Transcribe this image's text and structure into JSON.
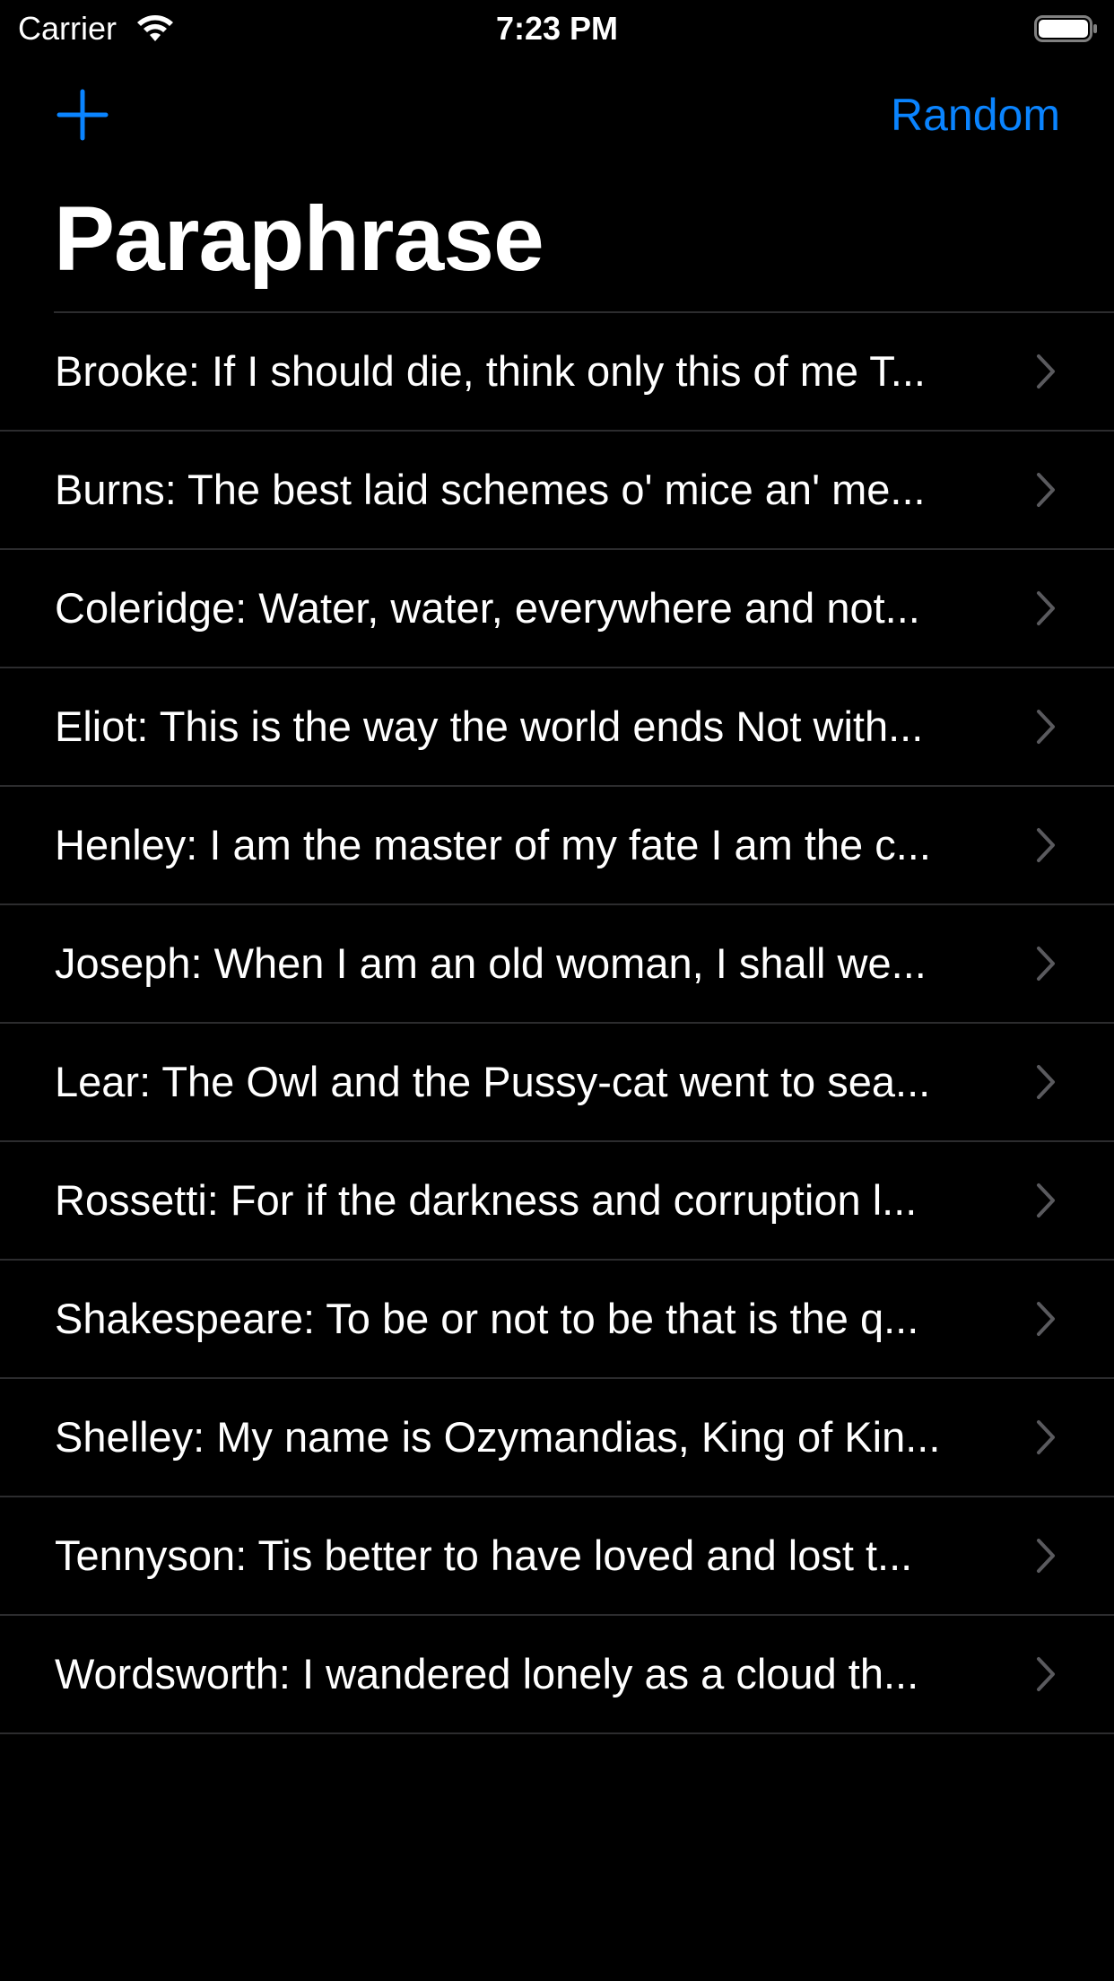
{
  "status_bar": {
    "carrier": "Carrier",
    "time": "7:23 PM"
  },
  "nav": {
    "add_icon": "plus-icon",
    "random_label": "Random",
    "accent_color": "#0a84ff"
  },
  "title": "Paraphrase",
  "items": [
    {
      "label": "Brooke: If I should die, think only this of me T..."
    },
    {
      "label": "Burns: The best laid schemes o' mice an' me..."
    },
    {
      "label": "Coleridge: Water, water, everywhere and not..."
    },
    {
      "label": "Eliot: This is the way the world ends Not with..."
    },
    {
      "label": "Henley: I am the master of my fate I am the c..."
    },
    {
      "label": "Joseph: When I am an old woman, I shall we..."
    },
    {
      "label": "Lear: The Owl and the Pussy-cat went to sea..."
    },
    {
      "label": "Rossetti: For if the darkness and corruption l..."
    },
    {
      "label": "Shakespeare: To be or not to be that is the q..."
    },
    {
      "label": "Shelley: My name is Ozymandias, King of Kin..."
    },
    {
      "label": "Tennyson: Tis better to have loved and lost t..."
    },
    {
      "label": "Wordsworth: I wandered lonely as a cloud th..."
    }
  ]
}
